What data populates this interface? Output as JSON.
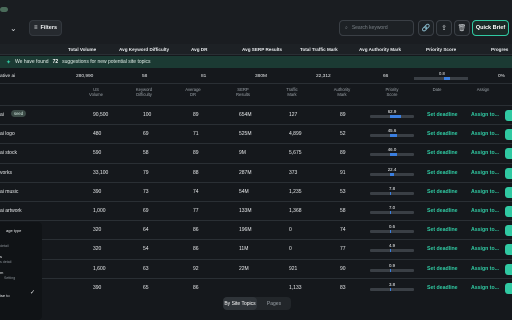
{
  "toolbar": {
    "filters_label": "Filters",
    "filters_icon": "filter-icon",
    "search_placeholder": "Search keyword",
    "quick_brief_label": "Quick Brief"
  },
  "header": {
    "total_volume": "Total Volume",
    "avg_keyword_difficulty": "Avg Keyword Difficulty",
    "avg_dr": "Avg DR",
    "avg_serp_results": "Avg SERP Results",
    "total_traffic_mark": "Total Traffic Mark",
    "avg_authority_mark": "Avg Authority Mark",
    "priority_score": "Priority Score",
    "progress": "Progres"
  },
  "banner": {
    "prefix": "We have found",
    "count": "72",
    "suffix": "suggestions for new potential site topics"
  },
  "summary": {
    "keyword": "ative ai",
    "total_volume": "280,990",
    "avg_kd": "58",
    "avg_dr": "81",
    "avg_serp": "380M",
    "total_traffic": "22,312",
    "avg_authority": "66",
    "priority": "0.8",
    "progress": "0%"
  },
  "columns": {
    "volume": "US\nVolume",
    "kd": "Keyword\nDifficulty",
    "dr": "Average\nDR",
    "serp": "SERP\nResults",
    "traffic": "Traffic\nMark",
    "authority": "Authority\nMark",
    "priority": "Priority\nScore",
    "date": "Date",
    "assign": "Assign"
  },
  "rows": [
    {
      "kw": "ai",
      "tag": "seed",
      "vol": "90,500",
      "kd": "100",
      "dr": "89",
      "serp": "654M",
      "traffic": "127",
      "auth": "89",
      "ps": "62.9",
      "ps_fill": 0.45
    },
    {
      "kw": "ai logo",
      "tag": "",
      "vol": "480",
      "kd": "69",
      "dr": "71",
      "serp": "525M",
      "traffic": "4,899",
      "auth": "52",
      "ps": "45.6",
      "ps_fill": 0.3
    },
    {
      "kw": "ai stock",
      "tag": "",
      "vol": "590",
      "kd": "58",
      "dr": "89",
      "serp": "9M",
      "traffic": "5,675",
      "auth": "89",
      "ps": "46.0",
      "ps_fill": 0.3
    },
    {
      "kw": "vorks",
      "tag": "",
      "vol": "33,100",
      "kd": "79",
      "dr": "88",
      "serp": "287M",
      "traffic": "373",
      "auth": "91",
      "ps": "22.4",
      "ps_fill": 0.15
    },
    {
      "kw": "ai music",
      "tag": "",
      "vol": "390",
      "kd": "73",
      "dr": "74",
      "serp": "54M",
      "traffic": "1,235",
      "auth": "53",
      "ps": "7.8",
      "ps_fill": 0.05
    },
    {
      "kw": "ai artwork",
      "tag": "",
      "vol": "1,000",
      "kd": "69",
      "dr": "77",
      "serp": "133M",
      "traffic": "1,368",
      "auth": "58",
      "ps": "7.0",
      "ps_fill": 0.05
    },
    {
      "kw": "",
      "tag": "",
      "vol": "320",
      "kd": "64",
      "dr": "86",
      "serp": "196M",
      "traffic": "0",
      "auth": "74",
      "ps": "0.6",
      "ps_fill": 0.02
    },
    {
      "kw": "",
      "tag": "",
      "vol": "320",
      "kd": "54",
      "dr": "86",
      "serp": "11M",
      "traffic": "0",
      "auth": "77",
      "ps": "4.9",
      "ps_fill": 0.03
    },
    {
      "kw": "",
      "tag": "",
      "vol": "1,600",
      "kd": "63",
      "dr": "92",
      "serp": "22M",
      "traffic": "921",
      "auth": "90",
      "ps": "0.9",
      "ps_fill": 0.02
    },
    {
      "kw": "",
      "tag": "",
      "vol": "390",
      "kd": "65",
      "dr": "86",
      "serp": "",
      "traffic": "1,133",
      "auth": "83",
      "ps": "3.8",
      "ps_fill": 0.03
    }
  ],
  "row_actions": {
    "deadline_label": "Set deadline",
    "assign_label": "Assign to..."
  },
  "dropdown": {
    "items": [
      "age type",
      "detail",
      "s",
      "s detail",
      "m",
      "Setting",
      "ise to"
    ]
  },
  "view_toggle": {
    "site_topics": "By Site Topics",
    "pages": "Pages"
  },
  "colors": {
    "accent": "#30c9a2",
    "progress_blue": "#3b7fe0",
    "background": "#15181c"
  }
}
